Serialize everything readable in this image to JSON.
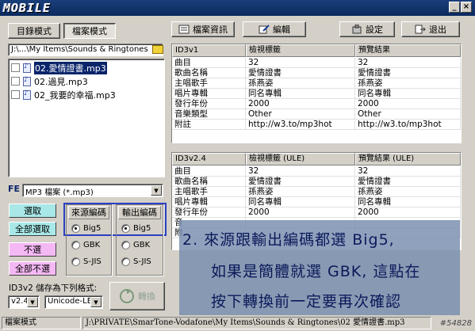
{
  "app": {
    "logo_text": "MOBILE"
  },
  "tabs": {
    "folder_mode": "目錄模式",
    "file_mode": "檔案模式"
  },
  "toolbar": {
    "file_info": "檔案資訊",
    "edit": "編輯",
    "settings": "設定",
    "exit": "退出"
  },
  "path": "J:\\...\\My Items\\Sounds & Ringtones",
  "files": [
    {
      "name": "02.愛情證書.mp3",
      "selected": true
    },
    {
      "name": "02.過見.mp3",
      "selected": false
    },
    {
      "name": "02_我要的幸福.mp3",
      "selected": false
    }
  ],
  "filter": {
    "label": "FE",
    "value": "MP3 檔案 (*.mp3)"
  },
  "buttons": {
    "select": "選取",
    "select_all": "全部選取",
    "deselect": "不選",
    "deselect_all": "全部不選",
    "convert": "轉換"
  },
  "encoding": {
    "source_title": "來源編碼",
    "output_title": "輸出編碼",
    "options": [
      "Big5",
      "GBK",
      "S-JIS"
    ],
    "source_selected": "Big5",
    "output_selected": "Big5"
  },
  "save_as": {
    "label": "ID3v2 儲存為下列格式:",
    "version": "v2.4",
    "encoding": "Unicode-LE"
  },
  "id3v1": {
    "headers": [
      "ID3v1",
      "檢視標籤",
      "預覽結果"
    ],
    "rows": [
      [
        "曲目",
        "32",
        "32"
      ],
      [
        "歌曲名稱",
        "愛情證書",
        "愛情證書"
      ],
      [
        "主唱歌手",
        "孫燕姿",
        "孫燕姿"
      ],
      [
        "唱片專輯",
        "同名專輯",
        "同名專輯"
      ],
      [
        "發行年份",
        "2000",
        "2000"
      ],
      [
        "音樂類型",
        "Other",
        "Other"
      ],
      [
        "附註",
        "http://w3.to/mp3hot",
        "http://w3.to/mp3hot"
      ]
    ]
  },
  "id3v2": {
    "headers": [
      "ID3v2.4",
      "檢視標籤 (ULE)",
      "預覽結果 (ULE)"
    ],
    "rows": [
      [
        "曲目",
        "32",
        "32"
      ],
      [
        "歌曲名稱",
        "愛情證書",
        "愛情證書"
      ],
      [
        "主唱歌手",
        "孫燕姿",
        "孫燕姿"
      ],
      [
        "唱片專輯",
        "同名專輯",
        "同名專輯"
      ],
      [
        "發行年份",
        "2000",
        "2000"
      ],
      [
        "音",
        "",
        ""
      ],
      [
        "附",
        "",
        ""
      ]
    ]
  },
  "overlay": {
    "line1": "2. 來源跟輸出編碼都選 Big5,",
    "line2": "如果是簡體就選 GBK, 這點在",
    "line3": "按下轉換前一定要再次確認"
  },
  "status": {
    "mode": "檔案模式",
    "path": "J:\\PRIVATE\\SmarTone-Vodafone\\My Items\\Sounds & Ringtones\\02 愛情證書.mp3"
  },
  "watermark": "#54828"
}
